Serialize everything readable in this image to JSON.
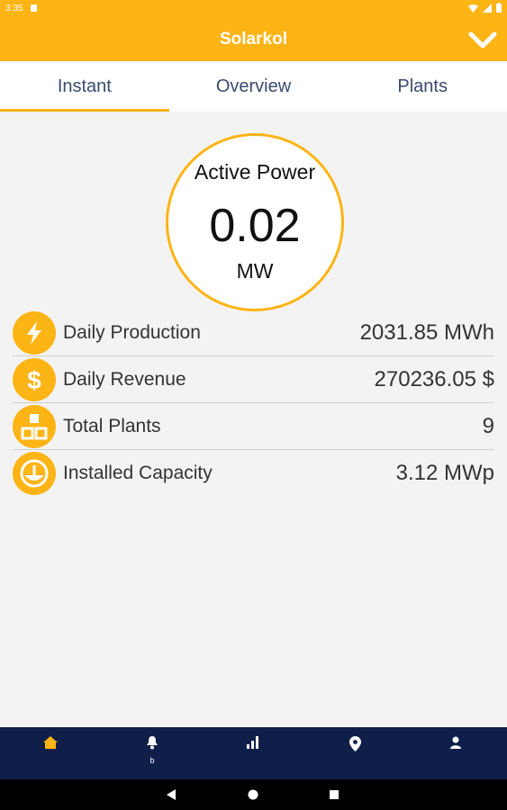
{
  "status": {
    "time": "3:35"
  },
  "app": {
    "title": "Solarkol"
  },
  "tabs": [
    {
      "label": "Instant"
    },
    {
      "label": "Overview"
    },
    {
      "label": "Plants"
    }
  ],
  "gauge": {
    "label": "Active Power",
    "value": "0.02",
    "unit": "MW"
  },
  "stats": [
    {
      "icon": "lightning-icon",
      "label": "Daily Production",
      "value": "2031.85 MWh"
    },
    {
      "icon": "dollar-icon",
      "label": "Daily Revenue",
      "value": "270236.05 $"
    },
    {
      "icon": "plants-icon",
      "label": "Total Plants",
      "value": "9"
    },
    {
      "icon": "capacity-icon",
      "label": "Installed Capacity",
      "value": "3.12 MWp"
    }
  ],
  "bottom_nav": {
    "items": [
      {
        "icon": "home-icon",
        "active": true
      },
      {
        "icon": "bell-icon",
        "badge": "b"
      },
      {
        "icon": "bar-chart-icon"
      },
      {
        "icon": "location-pin-icon"
      },
      {
        "icon": "user-icon"
      }
    ]
  },
  "colors": {
    "accent": "#fdb415",
    "nav_bg": "#0f1f4a",
    "text": "#333333"
  }
}
